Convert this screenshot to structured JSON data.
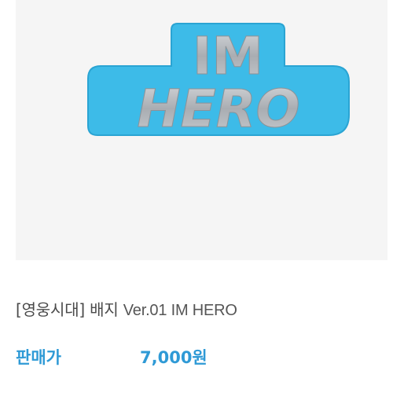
{
  "product": {
    "logo_line1": "IM",
    "logo_line2": "HERO",
    "title_prefix": "[영웅시대] 배지",
    "title_suffix": "Ver.01 IM HERO",
    "price_label": "판매가",
    "price_value": "7,000원"
  },
  "colors": {
    "accent_blue": "#2f9ad6",
    "logo_blue": "#3dbbe8",
    "logo_silver": "#b9bdc2",
    "image_bg": "#f5f5f5"
  }
}
